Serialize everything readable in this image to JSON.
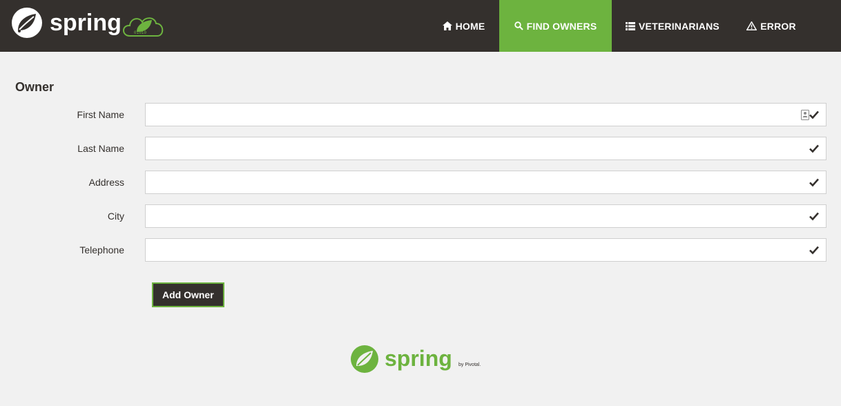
{
  "navbar": {
    "brand_word": "spring",
    "items": [
      {
        "label": "Home",
        "icon": "home-icon",
        "active": false
      },
      {
        "label": "Find owners",
        "icon": "search-icon",
        "active": true
      },
      {
        "label": "Veterinarians",
        "icon": "list-icon",
        "active": false
      },
      {
        "label": "Error",
        "icon": "warning-icon",
        "active": false
      }
    ]
  },
  "form": {
    "title": "Owner",
    "fields": [
      {
        "label": "First Name",
        "value": ""
      },
      {
        "label": "Last Name",
        "value": ""
      },
      {
        "label": "Address",
        "value": ""
      },
      {
        "label": "City",
        "value": ""
      },
      {
        "label": "Telephone",
        "value": ""
      }
    ],
    "submit_label": "Add Owner"
  },
  "footer": {
    "brand_word": "spring",
    "tagline": "by Pivotal."
  },
  "colors": {
    "dark": "#34302d",
    "accent": "#6db33f",
    "background": "#f1f1f1"
  }
}
